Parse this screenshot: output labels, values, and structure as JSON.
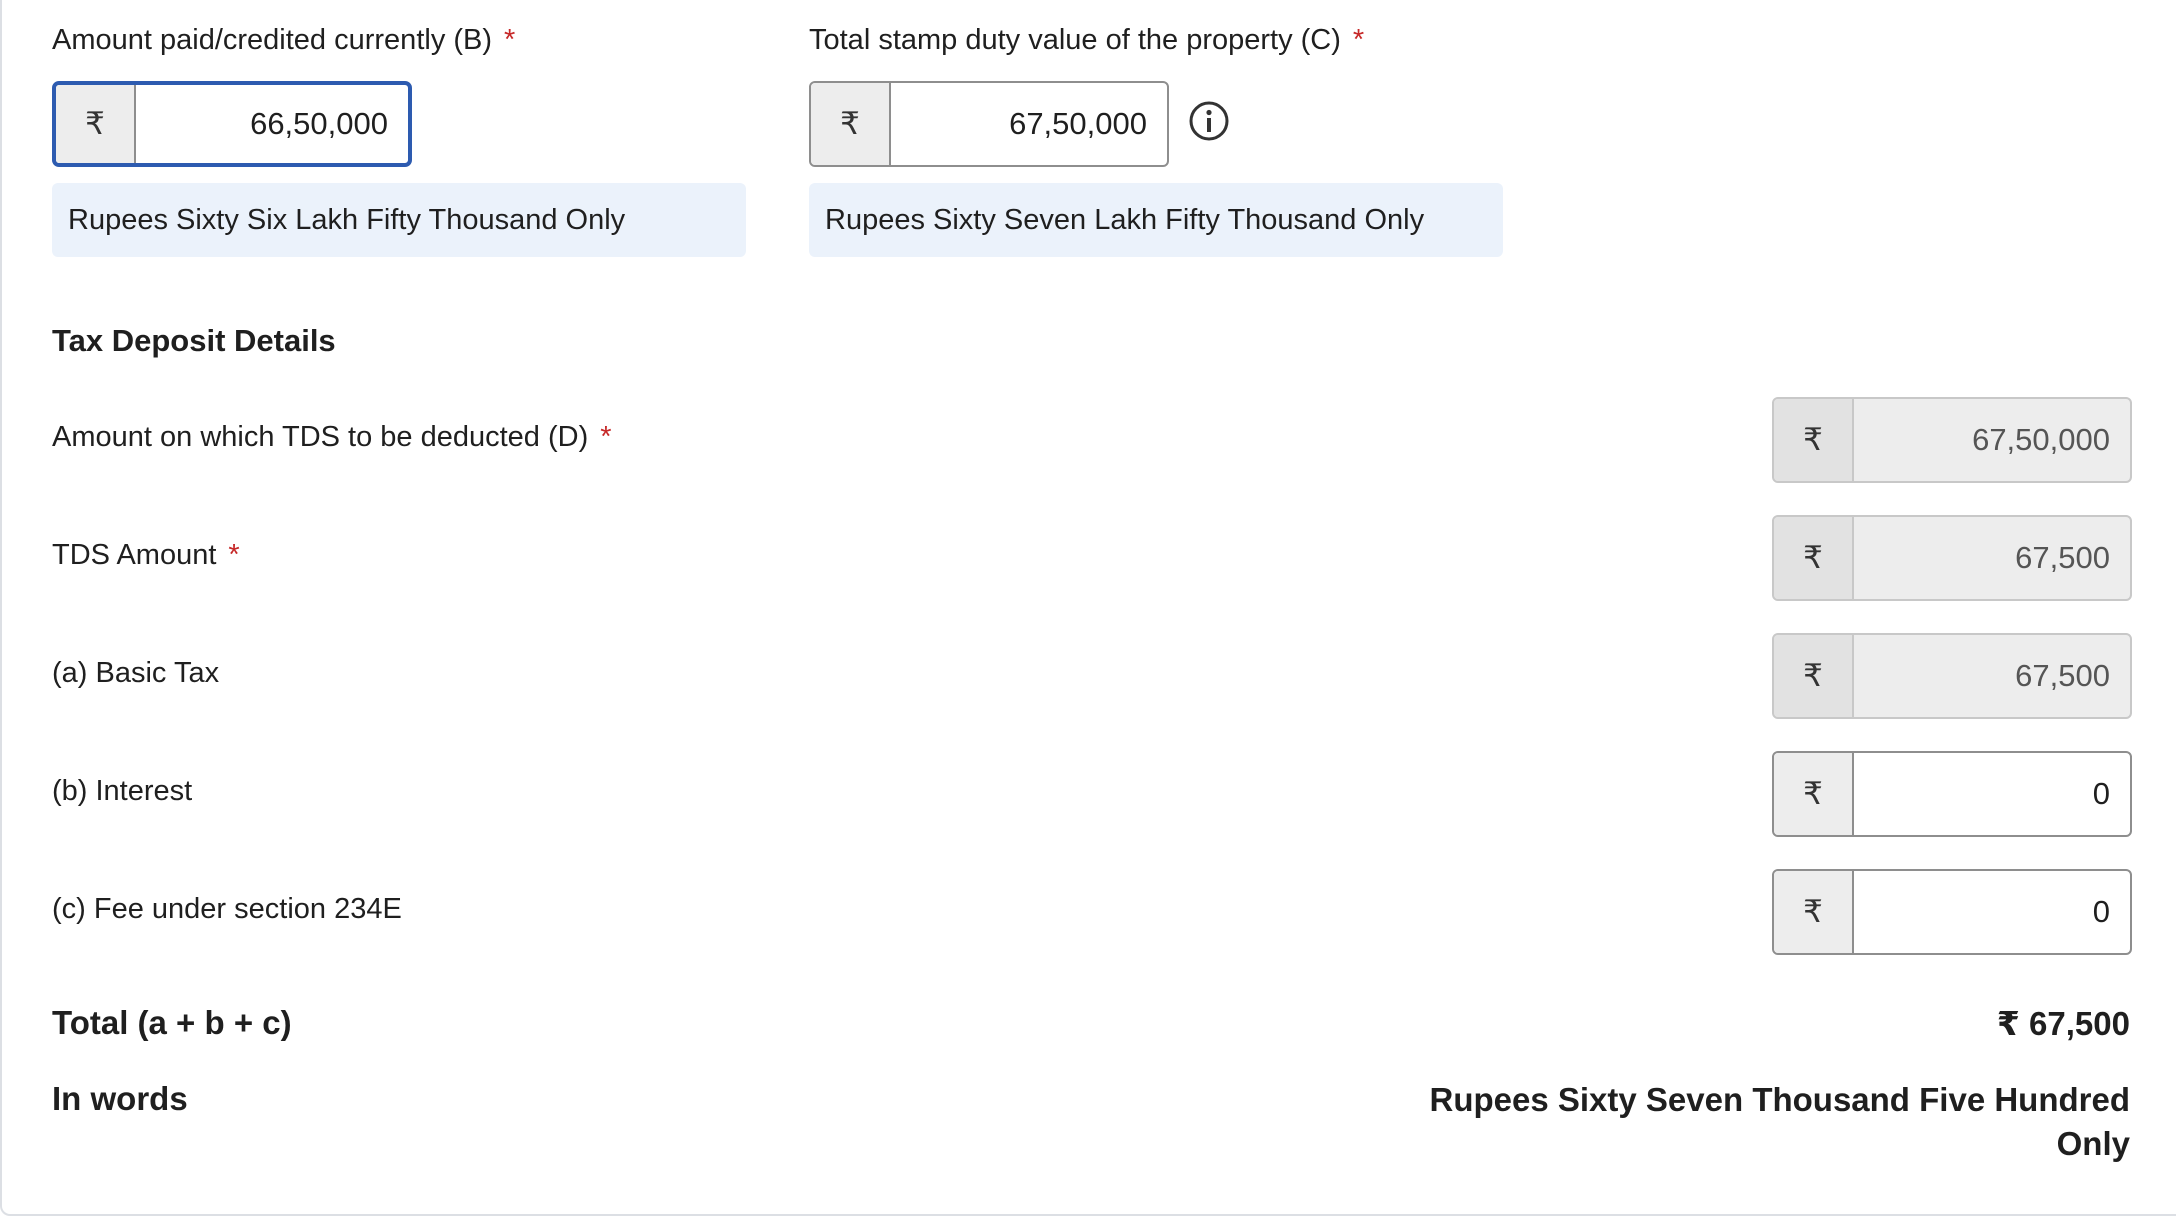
{
  "required_marker": "*",
  "currency_symbol": "₹",
  "paid_amount": {
    "label": "Amount paid/credited currently (B)",
    "value": "66,50,000",
    "in_words": "Rupees Sixty Six Lakh Fifty Thousand Only"
  },
  "stamp_duty": {
    "label": "Total stamp duty value of the property (C)",
    "value": "67,50,000",
    "in_words": "Rupees Sixty Seven Lakh Fifty Thousand Only"
  },
  "tax_deposit": {
    "title": "Tax Deposit Details",
    "tds_base": {
      "label": "Amount on which TDS to be deducted (D)",
      "value": "67,50,000"
    },
    "tds_amount": {
      "label": "TDS Amount",
      "value": "67,500"
    },
    "basic_tax": {
      "label": "(a) Basic Tax",
      "value": "67,500"
    },
    "interest": {
      "label": "(b) Interest",
      "value": "0"
    },
    "fee": {
      "label": "(c) Fee under section 234E",
      "value": "0"
    },
    "total": {
      "label": "Total (a + b + c)",
      "value": "₹ 67,500"
    },
    "in_words": {
      "label": "In words",
      "value_line1": "Rupees Sixty Seven Thousand Five Hundred",
      "value_line2": "Only"
    }
  },
  "colors": {
    "focus_border": "#2d5bb0",
    "required": "#c62828",
    "words_bg": "#ebf2fb"
  }
}
